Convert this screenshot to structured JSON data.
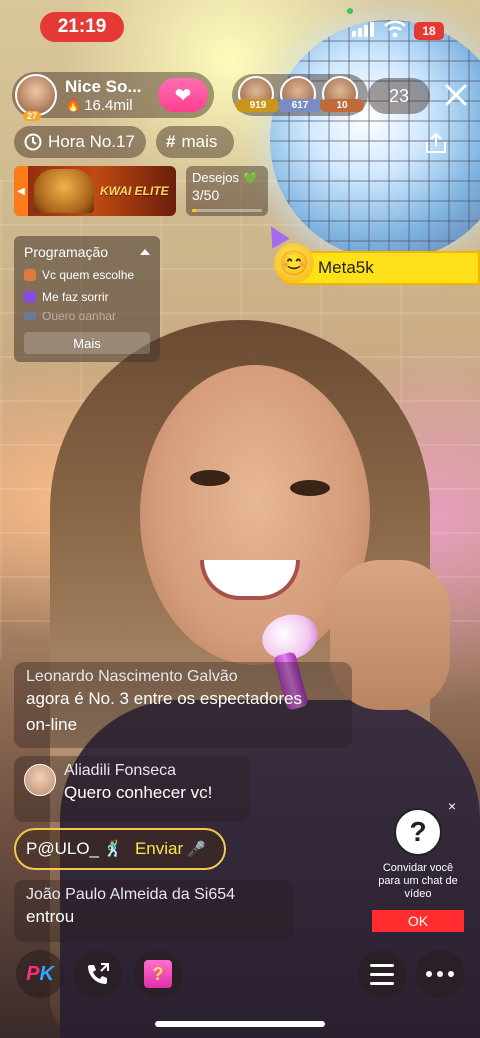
{
  "status_bar": {
    "time": "21:19",
    "battery": "18"
  },
  "host": {
    "name": "Nice So...",
    "likes": "16.4mil",
    "level": "27"
  },
  "viewers": {
    "top": [
      {
        "count": "919",
        "color": "#c9961a"
      },
      {
        "count": "617",
        "color": "#7a8cc4"
      },
      {
        "count": "10",
        "color": "#c06a3a"
      }
    ],
    "total": "23"
  },
  "hour_badge": {
    "label": "Hora No.17"
  },
  "tag": {
    "label": "mais"
  },
  "banner": {
    "brand": "KWAI ELITE"
  },
  "wishes": {
    "title": "Desejos",
    "count": "3/50",
    "progress": 0.06
  },
  "goal": {
    "label": "Meta5k"
  },
  "schedule": {
    "title": "Programação",
    "items": [
      {
        "label": "Vc quem escolhe",
        "color": "#e07a3a"
      },
      {
        "label": "Me faz sorrir",
        "color": "#8a4ae0"
      },
      {
        "label": "Quero ganhar",
        "color": "#4a8ae0"
      }
    ],
    "more": "Mais"
  },
  "comments": [
    {
      "name": "Leonardo Nascimento Galvão",
      "text_1": "agora é No. 3 entre os espectadores",
      "text_2": "on-line"
    },
    {
      "name": "Aliadili Fonseca",
      "text": "Quero conhecer vc!"
    },
    {
      "user": "P@ULO_",
      "action": "Enviar"
    },
    {
      "name": "João Paulo Almeida da Si654",
      "text": "entrou"
    }
  ],
  "invite": {
    "text": "Convidar você para um chat de vídeo",
    "ok": "OK",
    "close": "×"
  },
  "bottom_bar": {
    "pk_p": "P",
    "pk_k": "K",
    "gift_mark": "?"
  },
  "accent_colors": {
    "time_pill": "#e53935",
    "goal_yellow": "#ffe11a",
    "send_yellow": "#ffe44a",
    "ok_red": "#ff2d2d"
  }
}
